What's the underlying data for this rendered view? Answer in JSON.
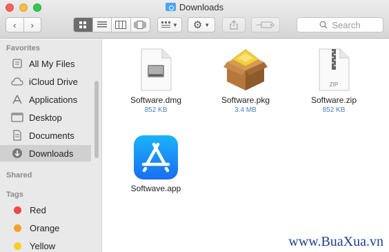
{
  "window": {
    "title": "Downloads"
  },
  "toolbar": {
    "back_icon": "chevron-left-icon",
    "forward_icon": "chevron-right-icon",
    "view_modes": [
      "icon-view",
      "list-view",
      "column-view",
      "coverflow-view"
    ],
    "active_view": "icon-view",
    "search_placeholder": "Search"
  },
  "sidebar": {
    "favorites_heading": "Favorites",
    "favorites": [
      {
        "label": "All My Files",
        "icon": "all-files-icon"
      },
      {
        "label": "iCloud Drive",
        "icon": "cloud-icon"
      },
      {
        "label": "Applications",
        "icon": "applications-icon"
      },
      {
        "label": "Desktop",
        "icon": "desktop-icon"
      },
      {
        "label": "Documents",
        "icon": "documents-icon"
      },
      {
        "label": "Downloads",
        "icon": "downloads-icon",
        "selected": true
      }
    ],
    "shared_heading": "Shared",
    "tags_heading": "Tags",
    "tags": [
      {
        "label": "Red",
        "color": "#f0464a"
      },
      {
        "label": "Orange",
        "color": "#f5a02a"
      },
      {
        "label": "Yellow",
        "color": "#f5cf28"
      }
    ]
  },
  "files": [
    {
      "name": "Software.dmg",
      "size": "852 KB",
      "icon": "disk-image-icon"
    },
    {
      "name": "Software.pkg",
      "size": "3.4 MB",
      "icon": "package-icon"
    },
    {
      "name": "Software.zip",
      "size": "852 KB",
      "icon": "zip-file-icon",
      "badge": "ZIP"
    },
    {
      "name": "Softwave.app",
      "size": "",
      "icon": "app-store-icon"
    }
  ],
  "watermark": "www.BuaXua.vn"
}
